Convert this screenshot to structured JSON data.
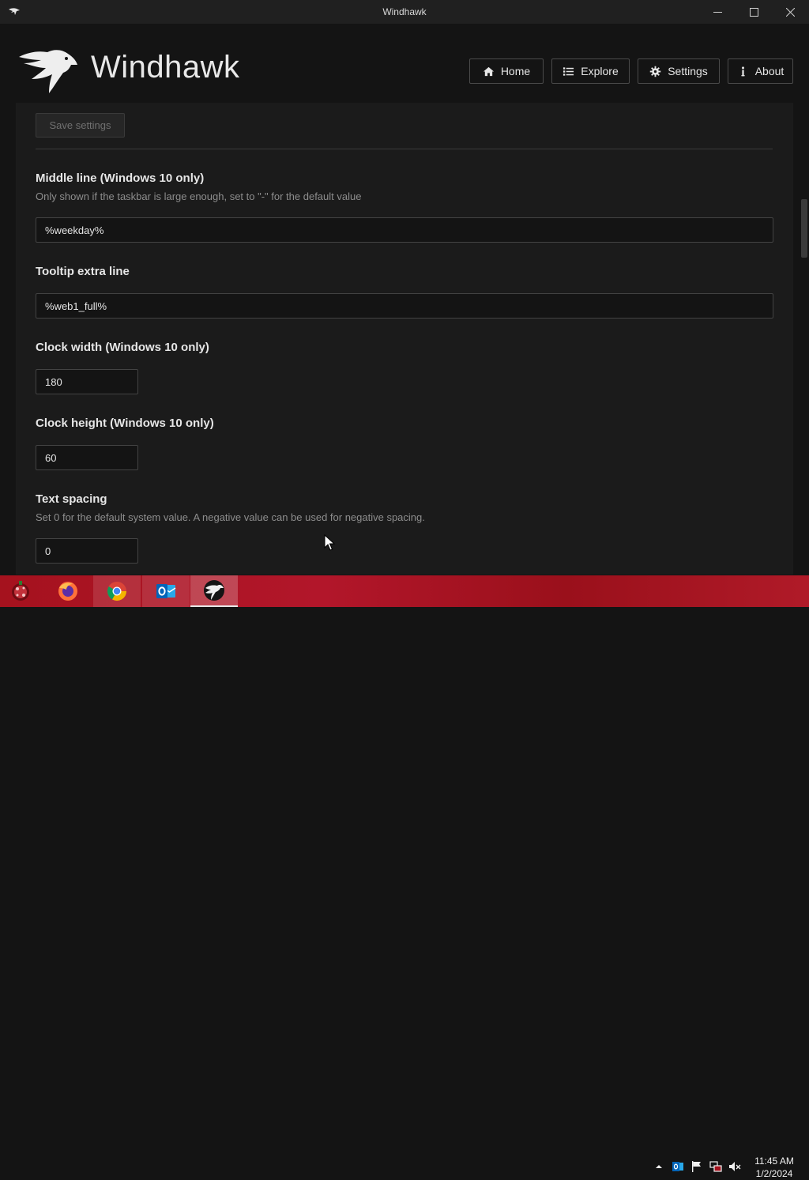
{
  "window": {
    "title": "Windhawk"
  },
  "header": {
    "brand": "Windhawk",
    "nav": {
      "home": "Home",
      "explore": "Explore",
      "settings": "Settings",
      "about": "About"
    }
  },
  "form": {
    "save_label": "Save settings",
    "middle_line": {
      "label": "Middle line (Windows 10 only)",
      "description": "Only shown if the taskbar is large enough, set to \"-\" for the default value",
      "value": "%weekday%"
    },
    "tooltip_extra_line": {
      "label": "Tooltip extra line",
      "value": "%web1_full%"
    },
    "clock_width": {
      "label": "Clock width (Windows 10 only)",
      "value": "180"
    },
    "clock_height": {
      "label": "Clock height (Windows 10 only)",
      "value": "60"
    },
    "text_spacing": {
      "label": "Text spacing",
      "description": "Set 0 for the default system value. A negative value can be used for negative spacing.",
      "value": "0"
    }
  },
  "taskbar": {
    "apps": [
      "start-icon",
      "firefox-icon",
      "chrome-icon",
      "outlook-icon",
      "windhawk-icon"
    ],
    "tray": [
      "chevron-up-icon",
      "outlook-tray-icon",
      "flag-icon",
      "network-icon",
      "volume-muted-icon"
    ],
    "clock_time": "11:45 AM",
    "clock_date": "1/2/2024"
  },
  "colors": {
    "background": "#141414",
    "panel": "#1b1b1b",
    "taskbar": "#a5121e",
    "text": "#e6e6e6",
    "muted": "#8d8d8d"
  }
}
